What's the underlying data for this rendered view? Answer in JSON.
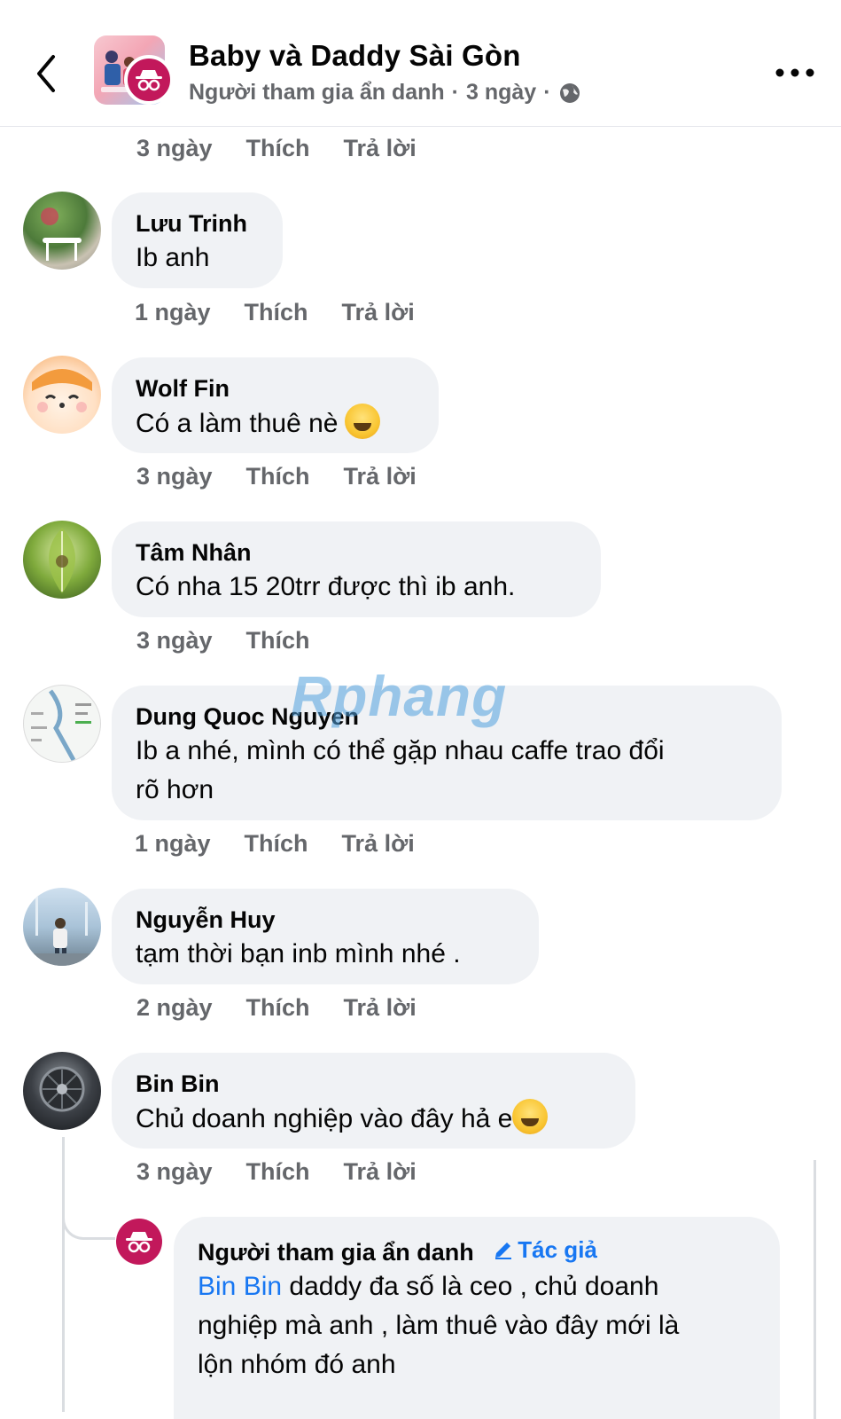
{
  "header": {
    "title": "Baby và Daddy Sài Gòn",
    "subtitle_author": "Người tham gia ẩn danh",
    "subtitle_time": "3 ngày",
    "separator": "·",
    "back_icon": "chevron-left-icon",
    "privacy_icon": "globe-icon",
    "more_icon": "more-horizontal-icon"
  },
  "top_actions": {
    "time": "3 ngày",
    "like": "Thích",
    "reply": "Trả lời"
  },
  "comments": [
    {
      "name": "Lưu Trinh",
      "text": "Ib anh",
      "time": "1 ngày",
      "like": "Thích",
      "reply": "Trả lời"
    },
    {
      "name": "Wolf Fin",
      "text": "Có a làm thuê nè",
      "emoji": "sweat-smile-emoji",
      "time": "3 ngày",
      "like": "Thích",
      "reply": "Trả lời"
    },
    {
      "name": "Tâm Nhân",
      "text": "Có nha 15 20trr được thì ib anh.",
      "time": "3 ngày",
      "like": "Thích"
    },
    {
      "name": "Dung Quoc Nguyen",
      "text_line1": "Ib a nhé, mình có thể gặp nhau caffe trao đổi",
      "text_line2": "rõ hơn",
      "time": "1 ngày",
      "like": "Thích",
      "reply": "Trả lời"
    },
    {
      "name": "Nguyễn Huy",
      "text": "tạm thời bạn inb mình nhé .",
      "time": "2 ngày",
      "like": "Thích",
      "reply": "Trả lời"
    },
    {
      "name": "Bin Bin",
      "text": "Chủ doanh nghiệp vào đây hả e",
      "emoji": "rofl-emoji",
      "time": "3 ngày",
      "like": "Thích",
      "reply": "Trả lời"
    }
  ],
  "reply": {
    "name": "Người tham gia ẩn danh",
    "author_badge": "Tác giả",
    "mention": "Bin Bin",
    "text_line1": " daddy đa số là ceo , chủ doanh",
    "text_line2": "nghiệp mà anh , làm thuê vào đây mới là",
    "text_line3": "lộn nhóm đó anh"
  },
  "watermark": "Rphang",
  "colors": {
    "link": "#1877f2",
    "muted": "#65676b",
    "bubble": "#f0f2f5",
    "anon": "#c2185b"
  }
}
